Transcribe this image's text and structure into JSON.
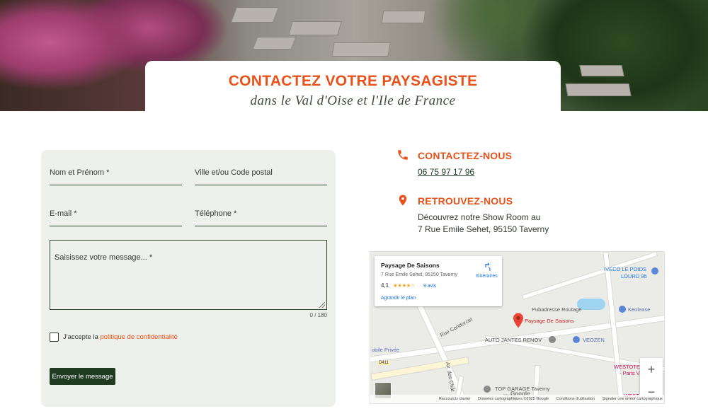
{
  "hero": {
    "title": "CONTACTEZ VOTRE PAYSAGISTE",
    "subtitle": "dans le Val d'Oise et l'Ile de France"
  },
  "form": {
    "name_label": "Nom et Prénom *",
    "city_label": "Ville et/ou Code postal",
    "email_label": "E-mail *",
    "phone_label": "Téléphone *",
    "message_placeholder": "Saisissez votre message... *",
    "counter": "0 / 180",
    "consent_prefix": "J'accepte la ",
    "consent_link": "politique de confidentialité",
    "submit_label": "Envoyer le message"
  },
  "contact": {
    "heading": "CONTACTEZ-NOUS",
    "phone": "06 75 97 17 96",
    "icon": "phone-icon"
  },
  "location": {
    "heading": "RETROUVEZ-NOUS",
    "line1": "Découvrez notre Show Room au",
    "line2": "7 Rue Emile Sehet, 95150 Taverny",
    "icon": "map-pin-icon"
  },
  "map": {
    "card": {
      "name": "Paysage De Saisons",
      "address": "7 Rue Emile Sehet, 95150 Taverny",
      "rating": "4,1",
      "stars": "★★★★☆",
      "reviews": "9 avis",
      "enlarge": "Agrandir le plan",
      "directions": "Itinéraires"
    },
    "labels": {
      "iveco": "IVECO LE POIDS",
      "iveco2": "LOURD 95",
      "pubadresse": "Pubadresse Routage",
      "keolease": "Keolease",
      "marker": "Paysage De Saisons",
      "condorcet": "Rue Condorcet",
      "auto_jantes": "AUTO JANTES RENOV",
      "veozen": "VEOZEN",
      "mobile": "obile Privée",
      "d411": "D411",
      "av_chat": "Av. des Chât",
      "westotel": "WESTOTEL",
      "westotel2": "- Paris V",
      "top_garage": "TOP GARAGE Taverny",
      "yenab": "Yenab",
      "best": "WEST \"T"
    },
    "footer": {
      "shortcuts": "Raccourcis clavier",
      "data": "Données cartographiques ©2025 Google",
      "terms": "Conditions d'utilisation",
      "report": "Signaler une erreur cartographique"
    },
    "zoom_in": "+",
    "zoom_out": "−",
    "google": "Google"
  },
  "colors": {
    "accent": "#e8521a",
    "dark_green": "#1f3b22",
    "panel": "#eef0eb"
  }
}
